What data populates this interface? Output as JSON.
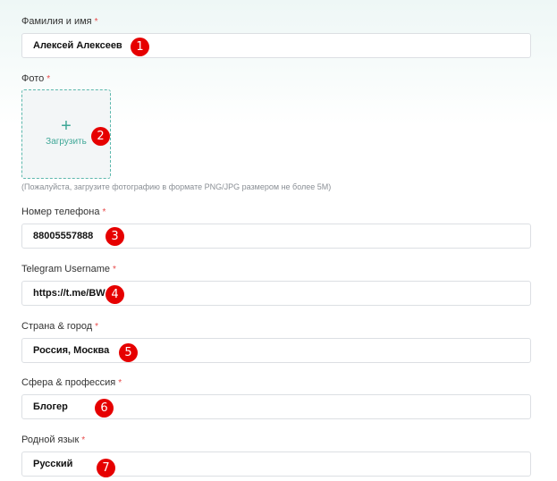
{
  "form": {
    "full_name": {
      "label": "Фамилия и имя",
      "required": "*",
      "value": "Алексей Алексеев"
    },
    "photo": {
      "label": "Фото",
      "required": "*",
      "upload_plus": "+",
      "upload_label": "Загрузить",
      "hint": "(Пожалуйста, загрузите фотографию в формате PNG/JPG размером не более 5M)"
    },
    "phone": {
      "label": "Номер телефона",
      "required": "*",
      "value": "88005557888"
    },
    "telegram": {
      "label": "Telegram Username",
      "required": "*",
      "value": "https://t.me/BW"
    },
    "location": {
      "label": "Страна & город",
      "required": "*",
      "value": "Россия, Москва"
    },
    "profession": {
      "label": "Сфера & профессия",
      "required": "*",
      "value": "Блогер"
    },
    "language": {
      "label": "Родной язык",
      "required": "*",
      "value": "Русский"
    }
  },
  "markers": [
    "1",
    "2",
    "3",
    "4",
    "5",
    "6",
    "7"
  ],
  "colors": {
    "accent": "#3fa797",
    "required": "#e84a4a",
    "marker": "#e60000",
    "border": "#dcdfe3"
  }
}
